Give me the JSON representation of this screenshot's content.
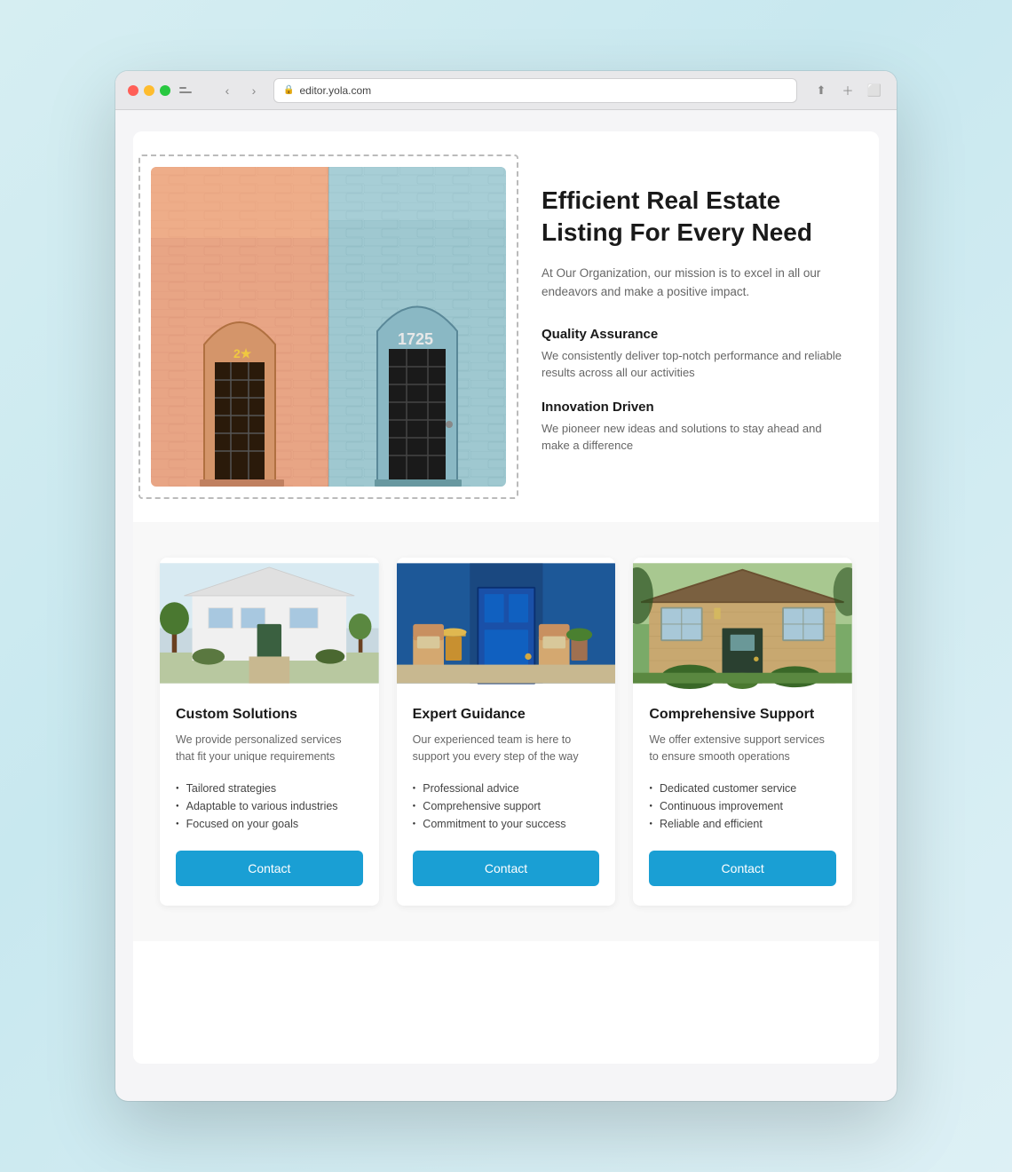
{
  "browser": {
    "url": "editor.yola.com",
    "back_label": "‹",
    "forward_label": "›"
  },
  "hero": {
    "title": "Efficient Real Estate Listing For Every Need",
    "description": "At Our Organization, our mission is to excel in all our endeavors and make a positive impact.",
    "features": [
      {
        "title": "Quality Assurance",
        "description": "We consistently deliver top-notch performance and reliable results across all our activities"
      },
      {
        "title": "Innovation Driven",
        "description": "We pioneer new ideas and solutions to stay ahead and make a difference"
      }
    ]
  },
  "cards": [
    {
      "title": "Custom Solutions",
      "description": "We provide personalized services that fit your unique requirements",
      "list_items": [
        "Tailored strategies",
        "Adaptable to various industries",
        "Focused on your goals"
      ],
      "button_label": "Contact"
    },
    {
      "title": "Expert Guidance",
      "description": "Our experienced team is here to support you every step of the way",
      "list_items": [
        "Professional advice",
        "Comprehensive support",
        "Commitment to your success"
      ],
      "button_label": "Contact"
    },
    {
      "title": "Comprehensive Support",
      "description": "We offer extensive support services to ensure smooth operations",
      "list_items": [
        "Dedicated customer service",
        "Continuous improvement",
        "Reliable and efficient"
      ],
      "button_label": "Contact"
    }
  ],
  "colors": {
    "button_blue": "#1a9fd4",
    "text_dark": "#1a1a1a",
    "text_muted": "#666666"
  }
}
